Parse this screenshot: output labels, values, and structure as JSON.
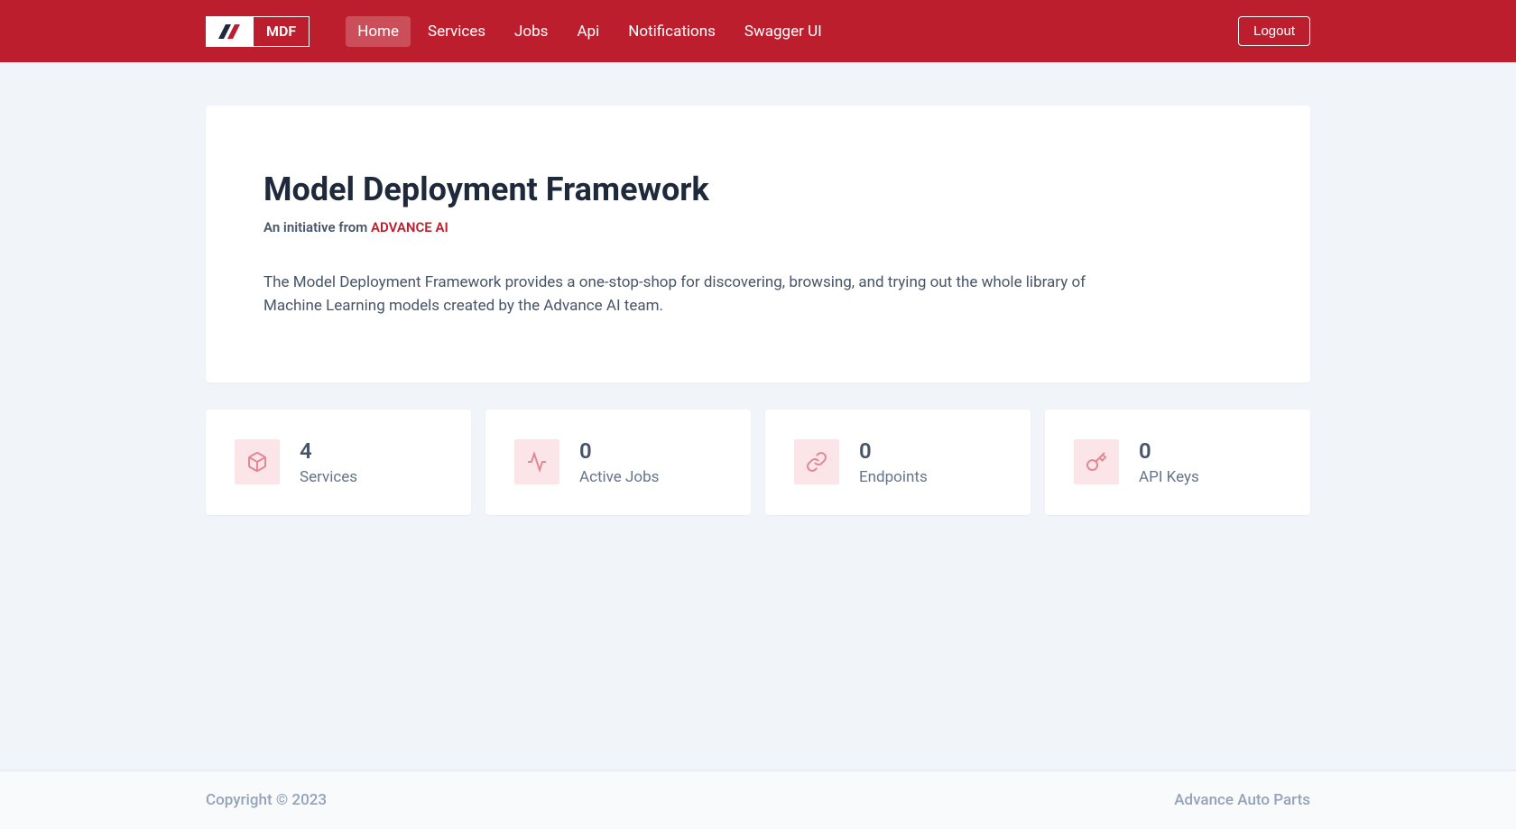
{
  "nav": {
    "logo_text": "MDF",
    "links": [
      {
        "label": "Home",
        "active": true
      },
      {
        "label": "Services",
        "active": false
      },
      {
        "label": "Jobs",
        "active": false
      },
      {
        "label": "Api",
        "active": false
      },
      {
        "label": "Notifications",
        "active": false
      },
      {
        "label": "Swagger UI",
        "active": false
      }
    ],
    "logout_label": "Logout"
  },
  "hero": {
    "title": "Model Deployment Framework",
    "subtitle_prefix": "An initiative from ",
    "subtitle_brand": "ADVANCE AI",
    "description": "The Model Deployment Framework provides a one-stop-shop for discovering, browsing, and trying out the whole library of Machine Learning models created by the Advance AI team."
  },
  "stats": [
    {
      "value": "4",
      "label": "Services",
      "icon": "cube-icon"
    },
    {
      "value": "0",
      "label": "Active Jobs",
      "icon": "activity-icon"
    },
    {
      "value": "0",
      "label": "Endpoints",
      "icon": "link-icon"
    },
    {
      "value": "0",
      "label": "API Keys",
      "icon": "key-icon"
    }
  ],
  "footer": {
    "copyright": "Copyright © 2023",
    "company": "Advance Auto Parts"
  }
}
